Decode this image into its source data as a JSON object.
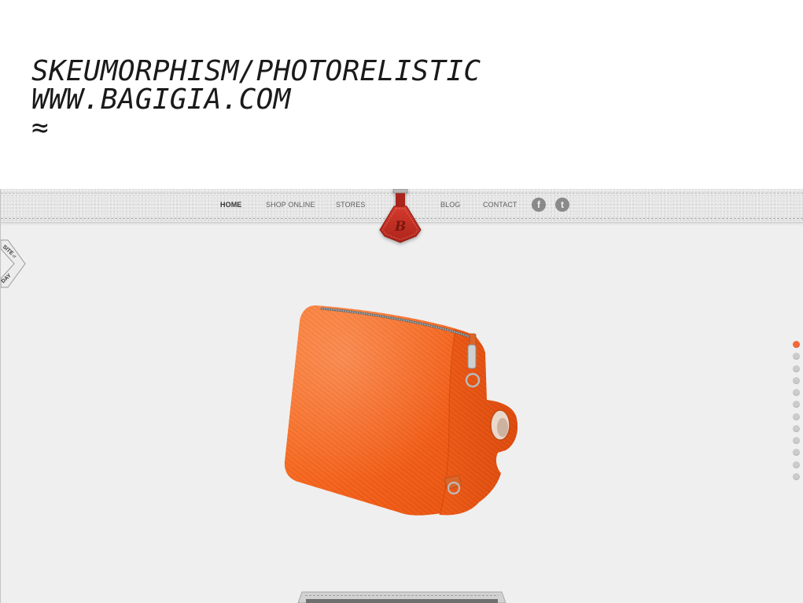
{
  "slide": {
    "heading_line1": "SKEUMORPHISM/PHOTORELISTIC",
    "heading_line2": "WWW.BAGIGIA.COM",
    "heading_symbol": "≈"
  },
  "site": {
    "nav_left": [
      {
        "label": "HOME",
        "active": true
      },
      {
        "label": "SHOP ONLINE",
        "active": false
      },
      {
        "label": "STORES",
        "active": false
      }
    ],
    "logo": {
      "letter": "B",
      "icon": "leather-tag-logo"
    },
    "nav_right": [
      {
        "label": "BLOG",
        "active": false
      },
      {
        "label": "CONTACT",
        "active": false
      }
    ],
    "social": [
      {
        "icon": "facebook-icon",
        "glyph": "f"
      },
      {
        "icon": "twitter-icon",
        "glyph": "t"
      }
    ],
    "badge": {
      "line1": "SITE",
      "line1_small": "of",
      "line2": "DAY"
    },
    "product": {
      "icon": "orange-handbag-image"
    },
    "pagination": {
      "total": 12,
      "active_index": 0
    },
    "bottom_tab": {
      "icon": "stitched-drawer-tab"
    }
  },
  "colors": {
    "slide_background": "#ffffff",
    "heading_text": "#1a1a1a",
    "site_background": "#efefef",
    "header_leather": "#e4e4e4",
    "nav_text": "#5e5e5e",
    "nav_active_text": "#333333",
    "logo_tag": "#d33a2c",
    "social_icon": "#8a8a8a",
    "product_orange": "#f8661f",
    "pagination_active": "#f26a3a",
    "pagination_inactive": "#cccccc"
  }
}
